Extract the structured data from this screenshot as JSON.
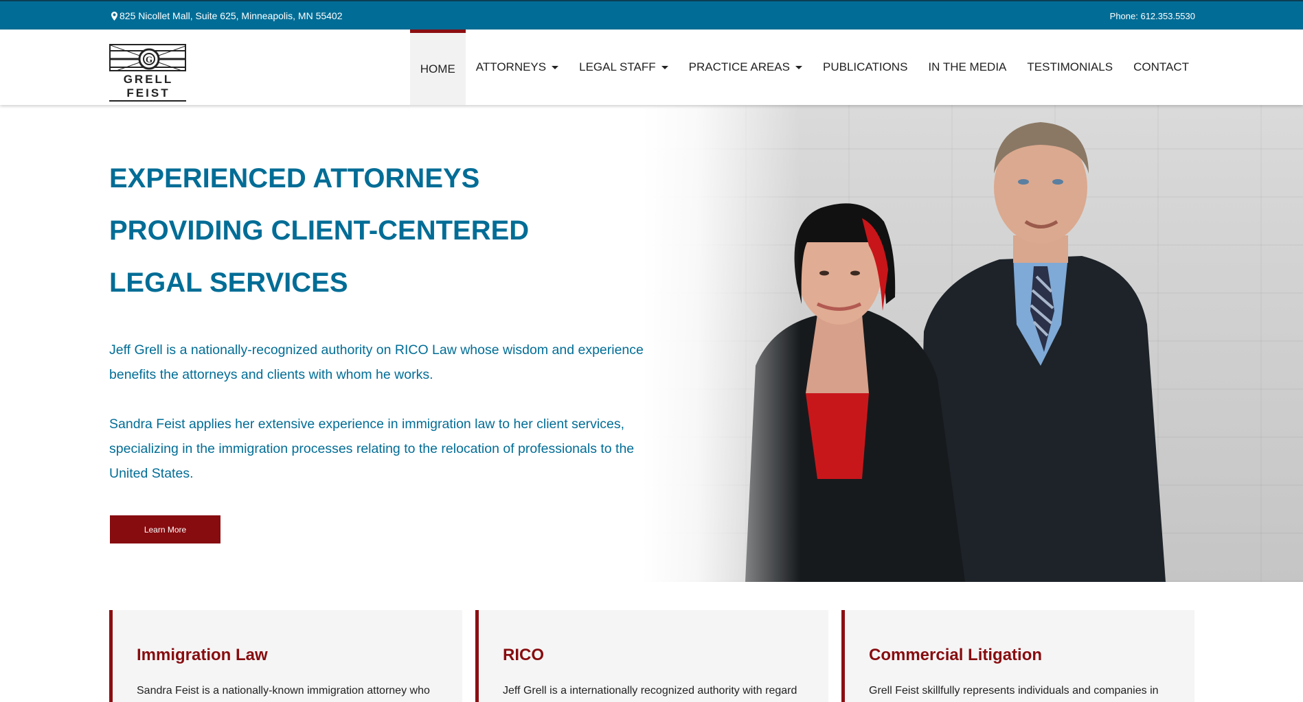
{
  "topbar": {
    "address": "825 Nicollet Mall, Suite 625, Minneapolis, MN 55402",
    "phone": "Phone: 612.353.5530",
    "icons": {
      "address": "map-marker-icon"
    }
  },
  "header": {
    "logo_text": "GRELL FEIST",
    "nav": [
      {
        "label": "HOME",
        "active": true,
        "dropdown": false
      },
      {
        "label": "ATTORNEYS",
        "active": false,
        "dropdown": true
      },
      {
        "label": "LEGAL STAFF",
        "active": false,
        "dropdown": true
      },
      {
        "label": "PRACTICE AREAS",
        "active": false,
        "dropdown": true
      },
      {
        "label": "PUBLICATIONS",
        "active": false,
        "dropdown": false
      },
      {
        "label": "IN THE MEDIA",
        "active": false,
        "dropdown": false
      },
      {
        "label": "TESTIMONIALS",
        "active": false,
        "dropdown": false
      },
      {
        "label": "CONTACT",
        "active": false,
        "dropdown": false
      }
    ]
  },
  "hero": {
    "title_lines": [
      "EXPERIENCED ATTORNEYS",
      "PROVIDING CLIENT-CENTERED",
      "LEGAL SERVICES"
    ],
    "paragraph1": "Jeff Grell is a nationally-recognized authority on RICO Law whose wisdom and experience benefits the attorneys and clients with whom he works.",
    "paragraph2": "Sandra Feist applies her extensive experience in immigration law to her client services, specializing in the immigration processes relating to the relocation of professionals to the United States.",
    "button_label": "Learn More"
  },
  "cards": [
    {
      "title": "Immigration Law",
      "text": "Sandra Feist is a nationally-known immigration attorney who"
    },
    {
      "title": "RICO",
      "text": "Jeff Grell is a internationally recognized authority with regard"
    },
    {
      "title": "Commercial Litigation",
      "text": "Grell Feist skillfully represents individuals and companies in"
    }
  ],
  "colors": {
    "brand_blue": "#016d96",
    "brand_red": "#870c0f",
    "card_bg": "#f5f5f5"
  }
}
